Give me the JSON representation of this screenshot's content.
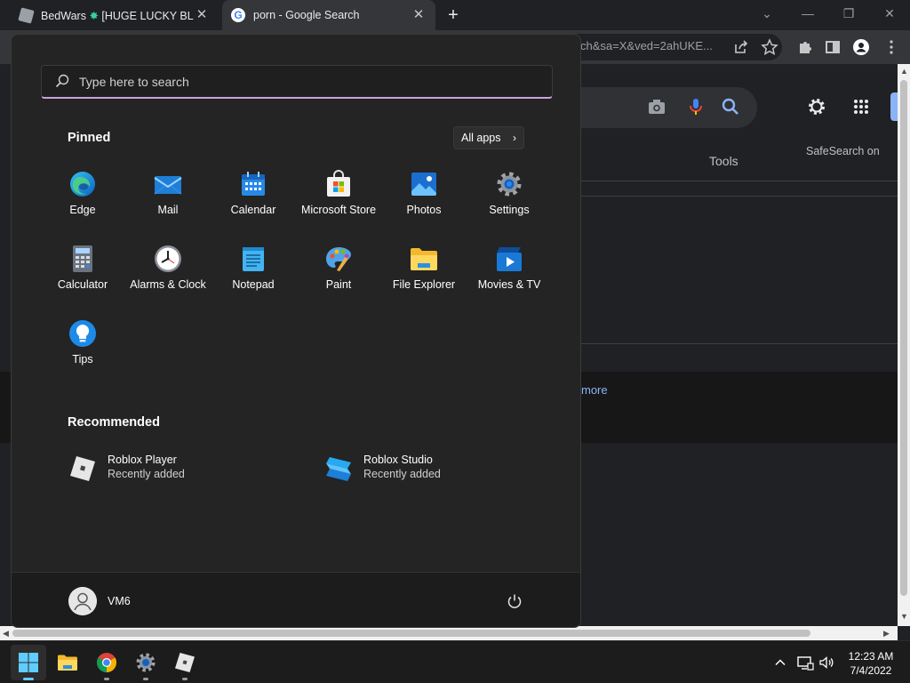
{
  "browser": {
    "tabs": [
      {
        "title": "BedWars",
        "badge": "✸",
        "title_rest": "[HUGE LUCKY BLOCKS]",
        "active": false
      },
      {
        "title": "porn - Google Search",
        "active": true
      }
    ],
    "new_tab": "+",
    "close_glyph": "✕",
    "url_fragment": "ch&sa=X&ved=2ahUKE...",
    "window_controls": {
      "dropdown": "⌄",
      "minimize": "—",
      "restore": "❐",
      "close": "✕"
    }
  },
  "google": {
    "tools_label": "Tools",
    "safesearch_label": "SafeSearch on",
    "more_link": "more",
    "colors": {
      "mic_blue": "#4285f4",
      "mic_red": "#ea4335",
      "link": "#8ab4f8"
    }
  },
  "start_menu": {
    "search_placeholder": "Type here to search",
    "pinned_title": "Pinned",
    "all_apps_label": "All apps",
    "pinned_apps": [
      {
        "label": "Edge",
        "icon": "edge-icon"
      },
      {
        "label": "Mail",
        "icon": "mail-icon"
      },
      {
        "label": "Calendar",
        "icon": "calendar-icon"
      },
      {
        "label": "Microsoft Store",
        "icon": "store-icon"
      },
      {
        "label": "Photos",
        "icon": "photos-icon"
      },
      {
        "label": "Settings",
        "icon": "settings-gear-icon"
      },
      {
        "label": "Calculator",
        "icon": "calculator-icon"
      },
      {
        "label": "Alarms & Clock",
        "icon": "clock-icon"
      },
      {
        "label": "Notepad",
        "icon": "notepad-icon"
      },
      {
        "label": "Paint",
        "icon": "paint-icon"
      },
      {
        "label": "File Explorer",
        "icon": "folder-icon"
      },
      {
        "label": "Movies & TV",
        "icon": "movies-icon"
      },
      {
        "label": "Tips",
        "icon": "lightbulb-icon"
      }
    ],
    "recommended_title": "Recommended",
    "recommended": [
      {
        "name": "Roblox Player",
        "subtitle": "Recently added",
        "icon": "roblox-player-icon"
      },
      {
        "name": "Roblox Studio",
        "subtitle": "Recently added",
        "icon": "roblox-studio-icon"
      }
    ],
    "user_name": "VM6"
  },
  "taskbar": {
    "items": [
      "start-icon",
      "file-explorer-icon",
      "chrome-icon",
      "settings-icon",
      "roblox-icon"
    ],
    "time": "12:23 AM",
    "date": "7/4/2022",
    "colors": {
      "start_accent": "#60cdff"
    }
  }
}
